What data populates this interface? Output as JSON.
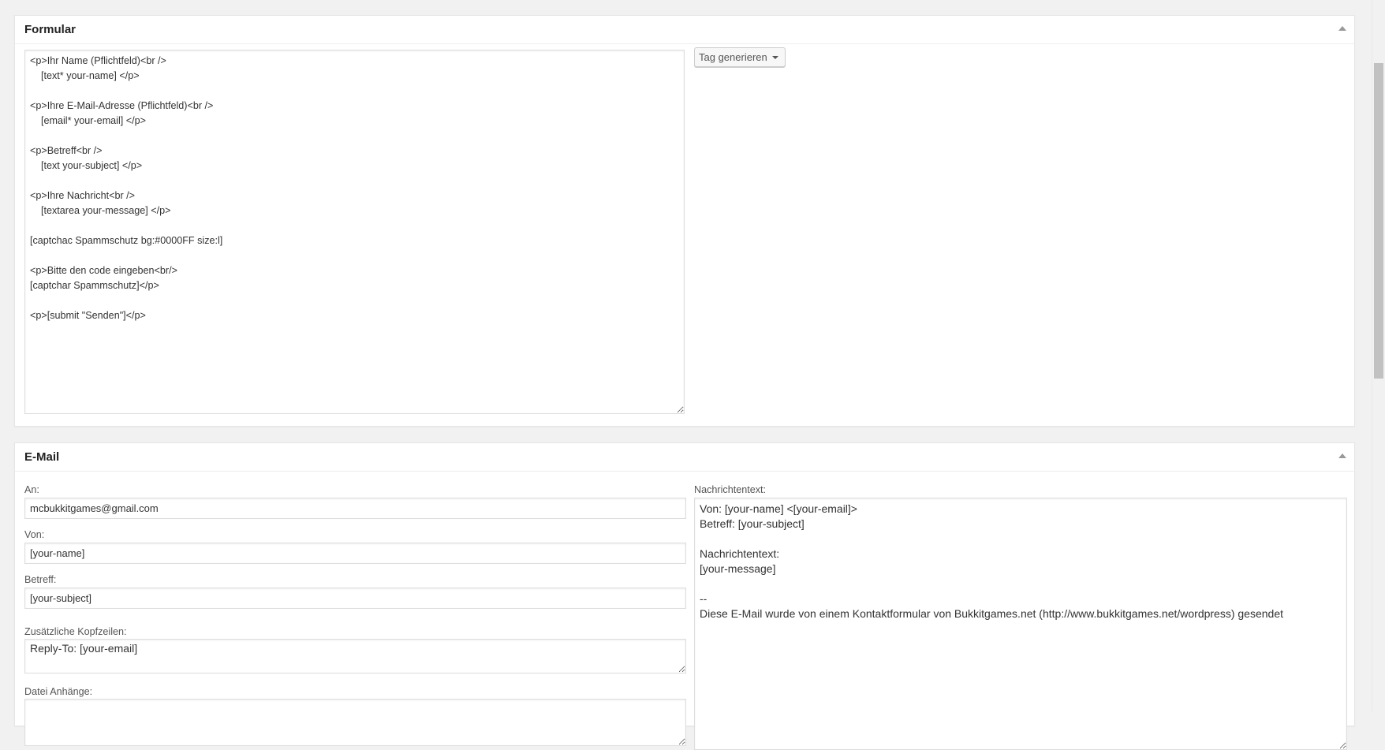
{
  "form_box": {
    "title": "Formular",
    "form_code": "<p>Ihr Name (Pflichtfeld)<br />\n    [text* your-name] </p>\n\n<p>Ihre E-Mail-Adresse (Pflichtfeld)<br />\n    [email* your-email] </p>\n\n<p>Betreff<br />\n    [text your-subject] </p>\n\n<p>Ihre Nachricht<br />\n    [textarea your-message] </p>\n\n[captchac Spammschutz bg:#0000FF size:l]\n\n<p>Bitte den code eingeben<br/>\n[captchar Spammschutz]</p>\n\n<p>[submit \"Senden\"]</p>",
    "tag_button": "Tag generieren"
  },
  "mail_box": {
    "title": "E-Mail",
    "to_label": "An:",
    "to_value": "mcbukkitgames@gmail.com",
    "from_label": "Von:",
    "from_value": "[your-name]",
    "subject_label": "Betreff:",
    "subject_value": "[your-subject]",
    "headers_label": "Zusätzliche Kopfzeilen:",
    "headers_value": "Reply-To: [your-email]",
    "attachments_label": "Datei Anhänge:",
    "attachments_value": "",
    "body_label": "Nachrichtentext:",
    "body_value": "Von: [your-name] <[your-email]>\nBetreff: [your-subject]\n\nNachrichtentext:\n[your-message]\n\n--\nDiese E-Mail wurde von einem Kontaktformular von Bukkitgames.net (http://www.bukkitgames.net/wordpress) gesendet"
  }
}
